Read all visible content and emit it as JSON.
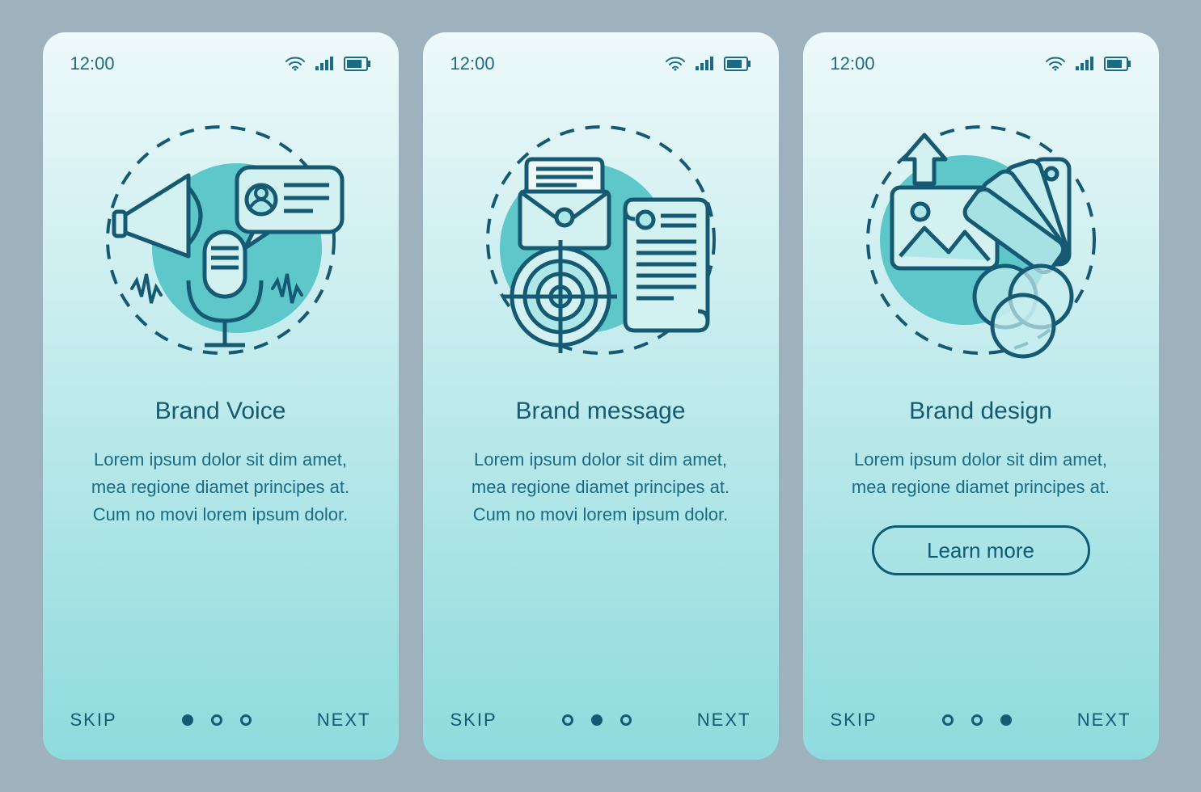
{
  "status": {
    "time": "12:00"
  },
  "screens": [
    {
      "title": "Brand Voice",
      "desc": "Lorem ipsum dolor sit dim amet, mea regione diamet principes at. Cum no movi lorem ipsum dolor.",
      "skip": "SKIP",
      "next": "NEXT",
      "learnMore": null,
      "activeDot": 0
    },
    {
      "title": "Brand message",
      "desc": "Lorem ipsum dolor sit dim amet, mea regione diamet principes at. Cum no movi lorem ipsum dolor.",
      "skip": "SKIP",
      "next": "NEXT",
      "learnMore": null,
      "activeDot": 1
    },
    {
      "title": "Brand design",
      "desc": "Lorem ipsum dolor sit dim amet, mea regione diamet principes at.",
      "skip": "SKIP",
      "next": "NEXT",
      "learnMore": "Learn more",
      "activeDot": 2
    }
  ]
}
